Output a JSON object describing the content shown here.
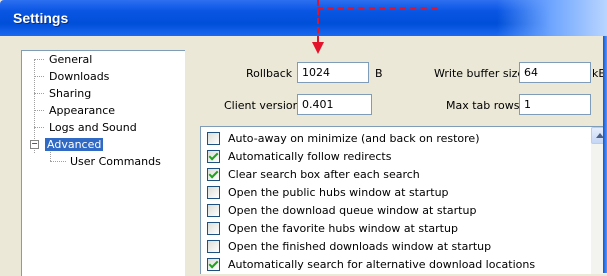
{
  "window": {
    "title": "Settings"
  },
  "tree": {
    "items": [
      {
        "label": "General"
      },
      {
        "label": "Downloads"
      },
      {
        "label": "Sharing"
      },
      {
        "label": "Appearance"
      },
      {
        "label": "Logs and Sound"
      },
      {
        "label": "Advanced",
        "selected": true,
        "expanded": true
      },
      {
        "label": "User Commands"
      }
    ],
    "expander_symbol": "−"
  },
  "settings": {
    "rollback": {
      "label": "Rollback",
      "value": "1024",
      "unit": "B"
    },
    "write_buffer": {
      "label": "Write buffer size",
      "value": "64",
      "unit": "kB"
    },
    "client_version": {
      "label": "Client version",
      "value": "0.401"
    },
    "max_tab_rows": {
      "label": "Max tab rows",
      "value": "1"
    }
  },
  "options": [
    {
      "label": "Auto-away on minimize (and back on restore)",
      "checked": false
    },
    {
      "label": "Automatically follow redirects",
      "checked": true
    },
    {
      "label": "Clear search box after each search",
      "checked": true
    },
    {
      "label": "Open the public hubs window at startup",
      "checked": false
    },
    {
      "label": "Open the download queue window at startup",
      "checked": false
    },
    {
      "label": "Open the favorite hubs window at startup",
      "checked": false
    },
    {
      "label": "Open the finished downloads window at startup",
      "checked": false
    },
    {
      "label": "Automatically search for alternative download locations",
      "checked": true
    }
  ],
  "colors": {
    "titlebar": "#0a56e4",
    "annotation": "#e2132b",
    "selection": "#316ac5",
    "check": "#21a121"
  }
}
